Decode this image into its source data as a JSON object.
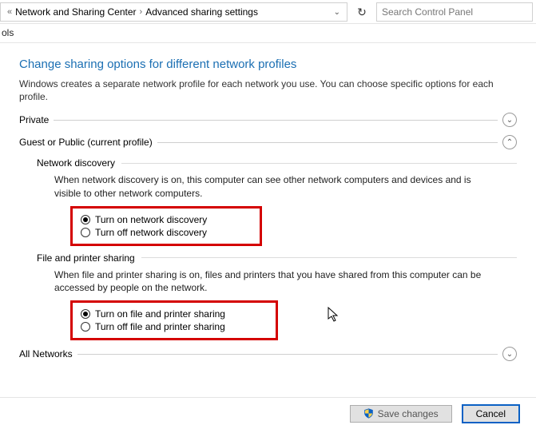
{
  "breadcrumb": {
    "parent": "Network and Sharing Center",
    "current": "Advanced sharing settings"
  },
  "search": {
    "placeholder": "Search Control Panel"
  },
  "toolbar": {
    "tools": "ols"
  },
  "page": {
    "title": "Change sharing options for different network profiles",
    "desc": "Windows creates a separate network profile for each network you use. You can choose specific options for each profile."
  },
  "sections": {
    "private": {
      "label": "Private"
    },
    "guest": {
      "label": "Guest or Public (current profile)"
    },
    "allnet": {
      "label": "All Networks"
    }
  },
  "network_discovery": {
    "title": "Network discovery",
    "desc": "When network discovery is on, this computer can see other network computers and devices and is visible to other network computers.",
    "on": "Turn on network discovery",
    "off": "Turn off network discovery"
  },
  "file_printer": {
    "title": "File and printer sharing",
    "desc": "When file and printer sharing is on, files and printers that you have shared from this computer can be accessed by people on the network.",
    "on": "Turn on file and printer sharing",
    "off": "Turn off file and printer sharing"
  },
  "footer": {
    "save": "Save changes",
    "cancel": "Cancel"
  }
}
